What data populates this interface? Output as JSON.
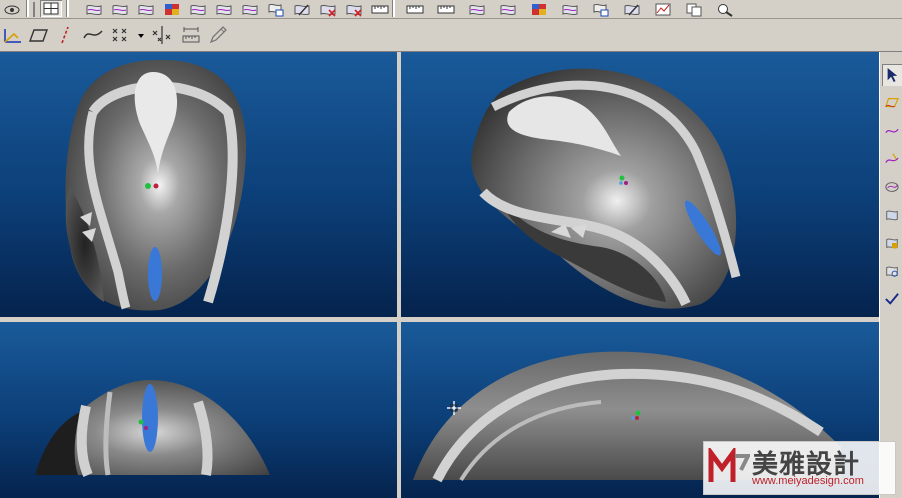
{
  "toolbar_top": {
    "icons": [
      "view-icon",
      "grid-icon",
      "surface-icon",
      "surface-icon",
      "surface-icon",
      "shade-icon",
      "surface-icon",
      "surface-icon",
      "surface-icon",
      "surface-copy-icon",
      "surface-edit-icon",
      "surface-delete-icon",
      "surface-delete-icon",
      "ruler-icon",
      "ruler-icon",
      "ruler-icon",
      "surface-icon",
      "surface-icon",
      "shade-icon",
      "surface-icon",
      "surface-copy-icon",
      "surface-edit-icon",
      "chart-icon",
      "copy-icon",
      "zoom-icon"
    ]
  },
  "toolbar_sketch": {
    "icons": [
      "axis-icon",
      "plane-icon",
      "line-icon",
      "curve-icon",
      "points-icon",
      "dropdown-arrow-icon",
      "cross-points-icon",
      "measure-icon",
      "pencil-icon"
    ]
  },
  "right_toolbar": {
    "icons": [
      "select-arrow-icon",
      "surface-from-curves-icon",
      "curve-icon",
      "sketch-curve-icon",
      "surface-check-icon",
      "surface-icon",
      "surface-edit-icon",
      "surface-copy-icon",
      "checkmark-icon"
    ]
  },
  "viewports": [
    {
      "name": "top-view"
    },
    {
      "name": "isometric-view"
    },
    {
      "name": "front-view"
    },
    {
      "name": "side-view"
    }
  ],
  "watermark": {
    "title": "美雅設計",
    "url": "www.meiyadesign.com"
  },
  "colors": {
    "viewport_top": "#1a5a9a",
    "viewport_bottom": "#05234d",
    "ui_gray": "#d4d0c8",
    "accent_blue": "#3a78d8",
    "brand_red": "#c0202a"
  }
}
